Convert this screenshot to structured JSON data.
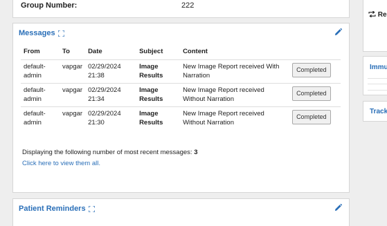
{
  "group": {
    "label": "Group Number:",
    "value": "222"
  },
  "messages": {
    "title": "Messages",
    "columns": [
      "From",
      "To",
      "Date",
      "Subject",
      "Content"
    ],
    "rows": [
      {
        "from": "default-admin",
        "to": "vapgar",
        "date": "02/29/2024 21:38",
        "subject": "Image Results",
        "content": "New Image Report received With Narration",
        "status": "Completed"
      },
      {
        "from": "default-admin",
        "to": "vapgar",
        "date": "02/29/2024 21:34",
        "subject": "Image Results",
        "content": "New Image Report received Without Narration",
        "status": "Completed"
      },
      {
        "from": "default-admin",
        "to": "vapgar",
        "date": "02/29/2024 21:30",
        "subject": "Image Results",
        "content": "New Image Report received Without Narration",
        "status": "Completed"
      }
    ],
    "summary_text": "Displaying the following number of most recent messages: ",
    "summary_count": "3",
    "view_all_link": "Click here to view them all."
  },
  "reminders": {
    "title": "Patient Reminders"
  },
  "right": {
    "panel1_label": "Re",
    "panel2_label": "Immu",
    "panel3_label": "Track"
  },
  "colors": {
    "link": "#2a6fb8",
    "panel_bg": "#ffffff",
    "page_bg": "#eeeeee"
  }
}
